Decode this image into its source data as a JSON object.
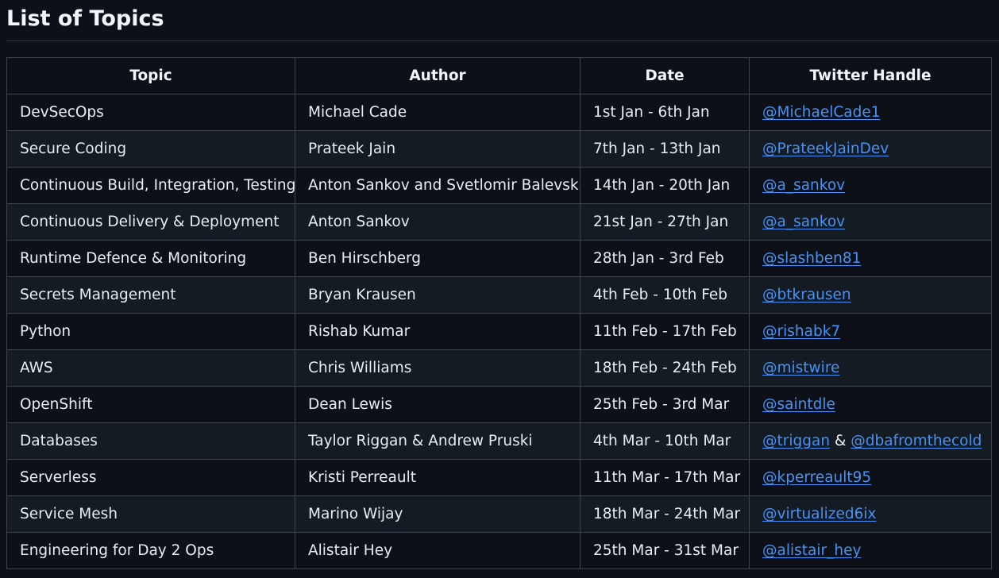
{
  "page": {
    "title": "List of Topics"
  },
  "table": {
    "headers": [
      "Topic",
      "Author",
      "Date",
      "Twitter Handle"
    ],
    "rows": [
      {
        "topic": "DevSecOps",
        "author": "Michael Cade",
        "date": "1st Jan - 6th Jan",
        "handles": [
          "@MichaelCade1"
        ]
      },
      {
        "topic": "Secure Coding",
        "author": "Prateek Jain",
        "date": "7th Jan - 13th Jan",
        "handles": [
          "@PrateekJainDev"
        ]
      },
      {
        "topic": "Continuous Build, Integration, Testing",
        "author": "Anton Sankov and Svetlomir Balevski",
        "date": "14th Jan - 20th Jan",
        "handles": [
          "@a_sankov"
        ]
      },
      {
        "topic": "Continuous Delivery & Deployment",
        "author": "Anton Sankov",
        "date": "21st Jan - 27th Jan",
        "handles": [
          "@a_sankov"
        ]
      },
      {
        "topic": "Runtime Defence & Monitoring",
        "author": "Ben Hirschberg",
        "date": "28th Jan - 3rd Feb",
        "handles": [
          "@slashben81"
        ]
      },
      {
        "topic": "Secrets Management",
        "author": "Bryan Krausen",
        "date": "4th Feb - 10th Feb",
        "handles": [
          "@btkrausen"
        ]
      },
      {
        "topic": "Python",
        "author": "Rishab Kumar",
        "date": "11th Feb - 17th Feb",
        "handles": [
          "@rishabk7"
        ]
      },
      {
        "topic": "AWS",
        "author": "Chris Williams",
        "date": "18th Feb - 24th Feb",
        "handles": [
          "@mistwire"
        ]
      },
      {
        "topic": "OpenShift",
        "author": "Dean Lewis",
        "date": "25th Feb - 3rd Mar",
        "handles": [
          "@saintdle"
        ]
      },
      {
        "topic": "Databases",
        "author": "Taylor Riggan & Andrew Pruski",
        "date": "4th Mar - 10th Mar",
        "handles": [
          "@triggan",
          "@dbafromthecold"
        ],
        "separator": " & "
      },
      {
        "topic": "Serverless",
        "author": "Kristi Perreault",
        "date": "11th Mar - 17th Mar",
        "handles": [
          "@kperreault95"
        ]
      },
      {
        "topic": "Service Mesh",
        "author": "Marino Wijay",
        "date": "18th Mar - 24th Mar",
        "handles": [
          "@virtualized6ix"
        ]
      },
      {
        "topic": "Engineering for Day 2 Ops",
        "author": "Alistair Hey",
        "date": "25th Mar - 31st Mar",
        "handles": [
          "@alistair_hey"
        ]
      }
    ]
  },
  "colors": {
    "background": "#0d1117",
    "row_alt": "#151b23",
    "border": "#3d444d",
    "link": "#4493f8",
    "text": "#e6edf3"
  }
}
